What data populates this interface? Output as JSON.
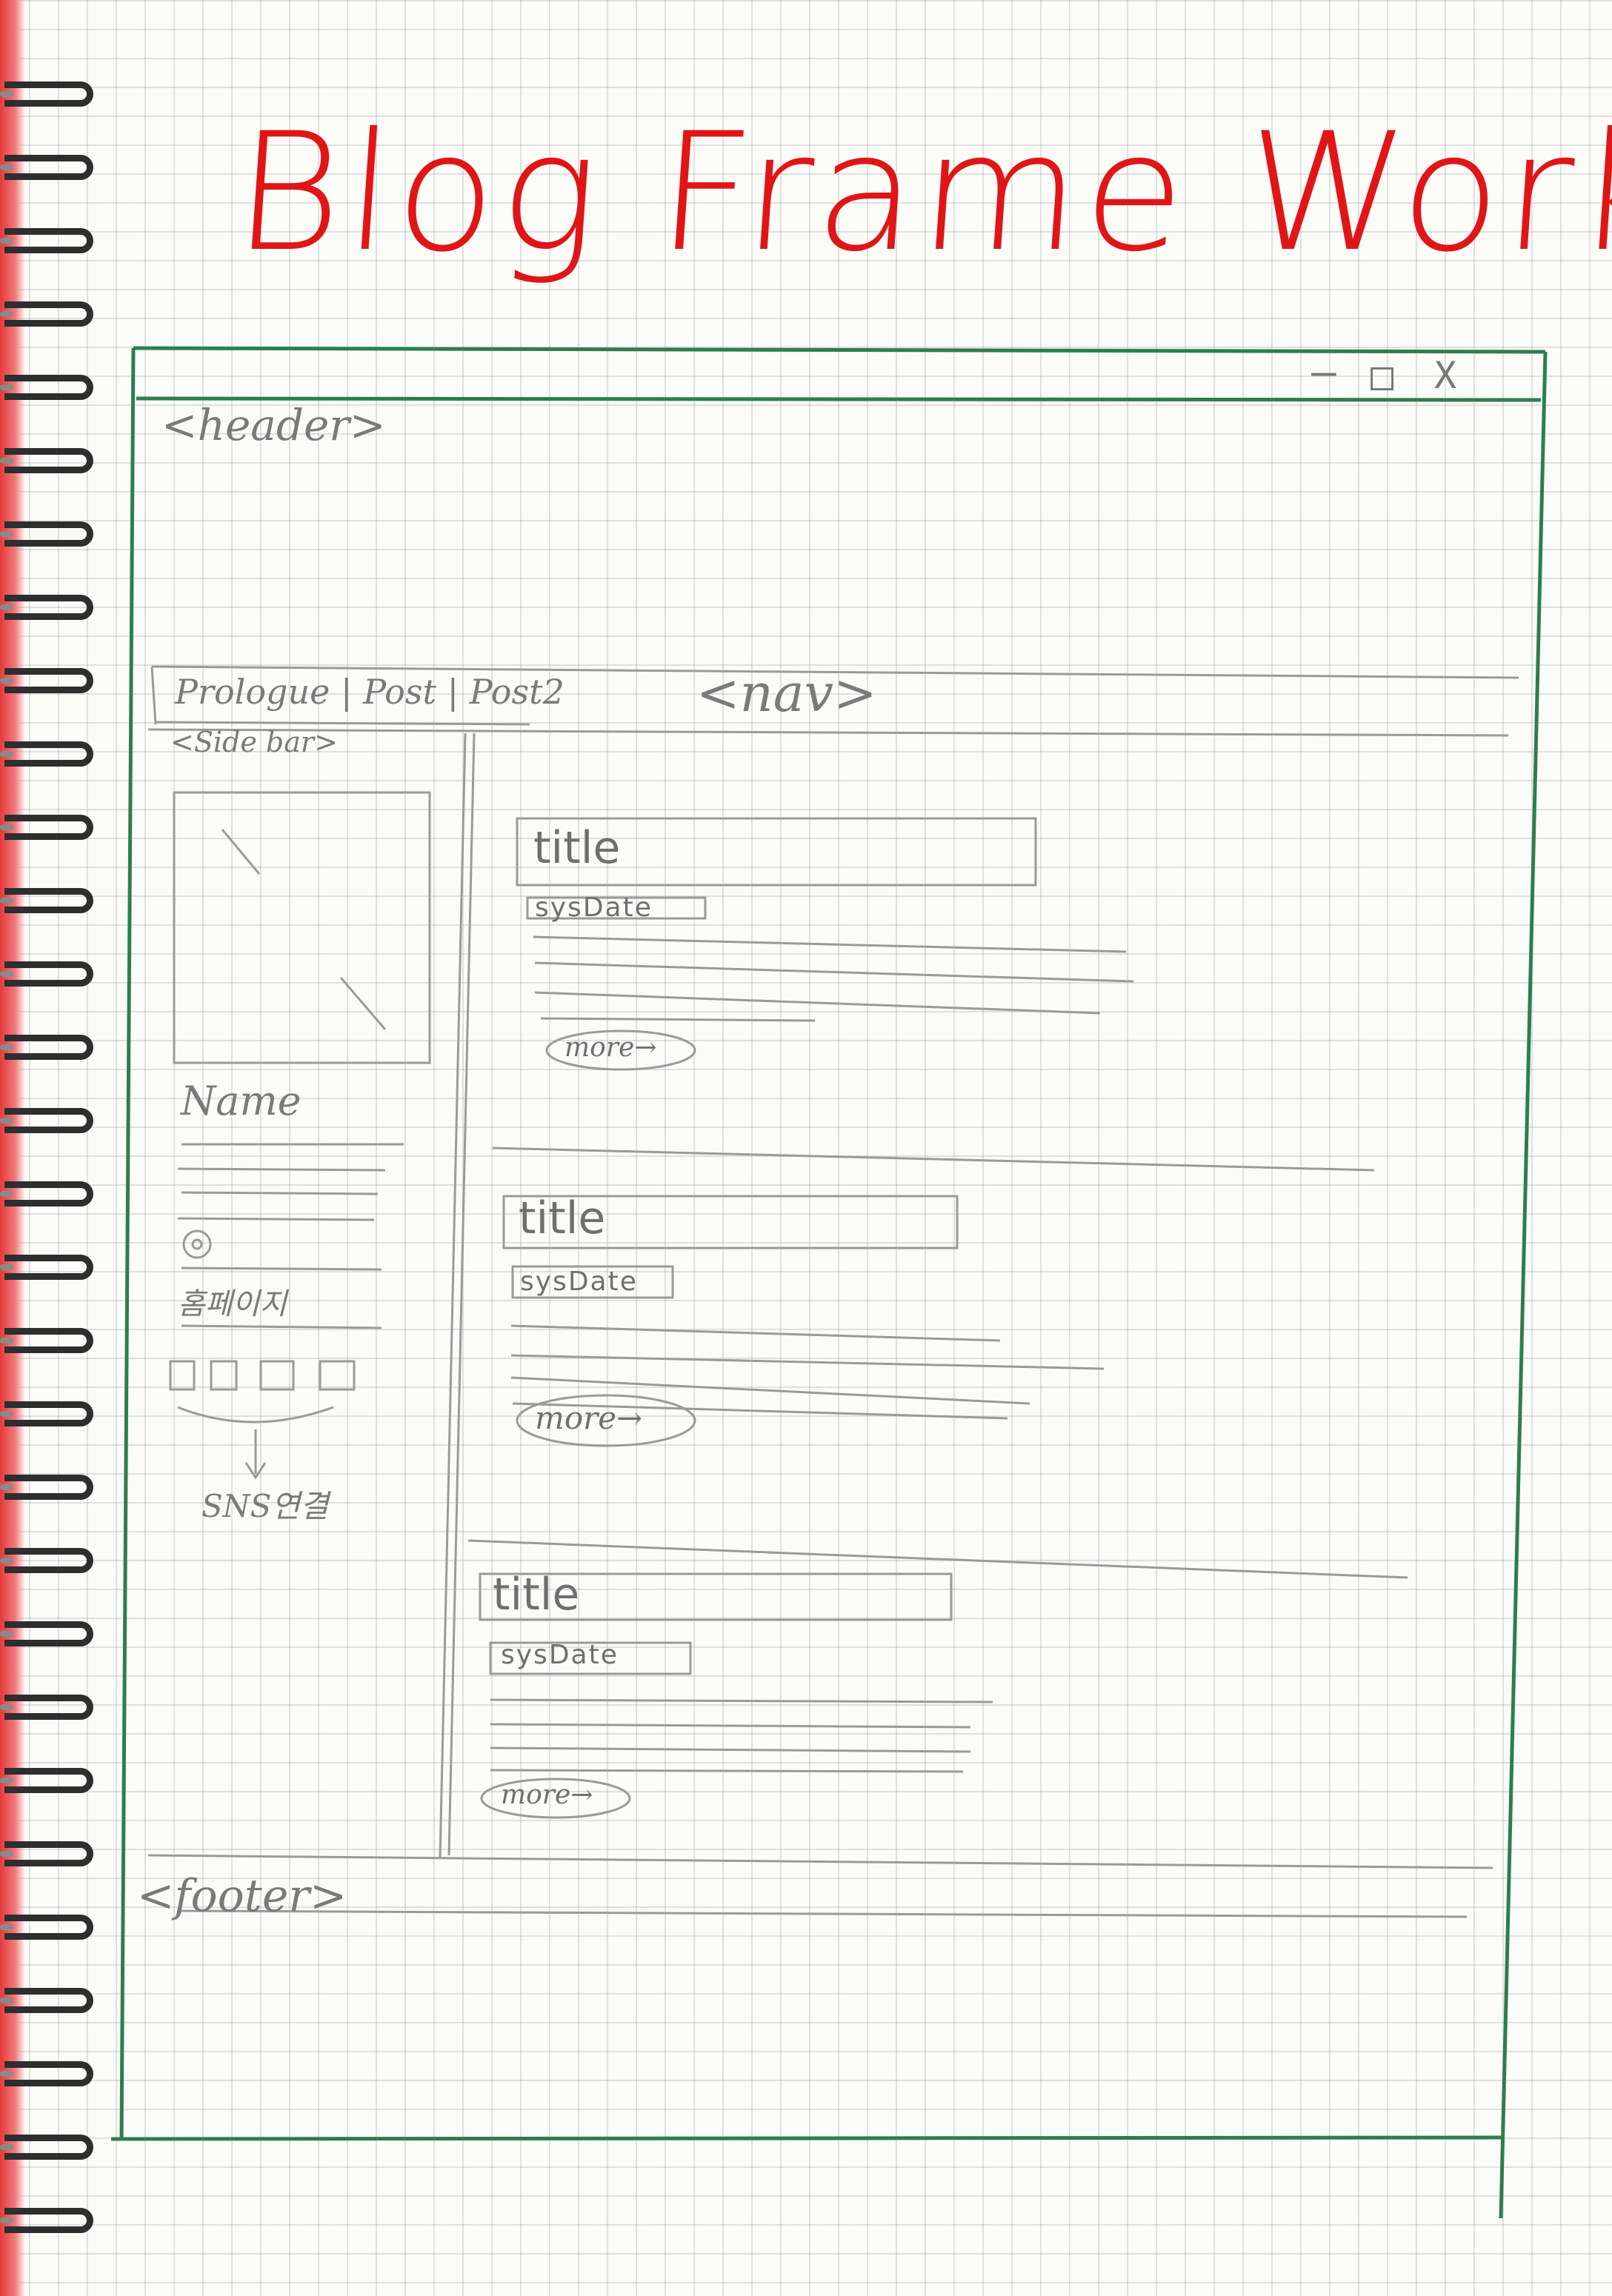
{
  "title": "Blog Frame Work",
  "header_label": "<header>",
  "window_controls": {
    "minimize": "–",
    "maximize": "□",
    "close": "X"
  },
  "nav": {
    "label": "<nav>",
    "links": "Prologue | Post | Post2"
  },
  "sidebar": {
    "label": "<Side bar>",
    "name_label": "Name",
    "homepage_label": "홈페이지",
    "sns_label": "SNS연결"
  },
  "posts": [
    {
      "title": "title",
      "date": "sysDate",
      "more": "more→"
    },
    {
      "title": "title",
      "date": "sysDate",
      "more": "more→"
    },
    {
      "title": "title",
      "date": "sysDate",
      "more": "more→"
    }
  ],
  "footer_label": "<footer>",
  "colors": {
    "title": "#e01616",
    "frame": "#2e7d4f",
    "pencil": "#8a8a8a"
  }
}
